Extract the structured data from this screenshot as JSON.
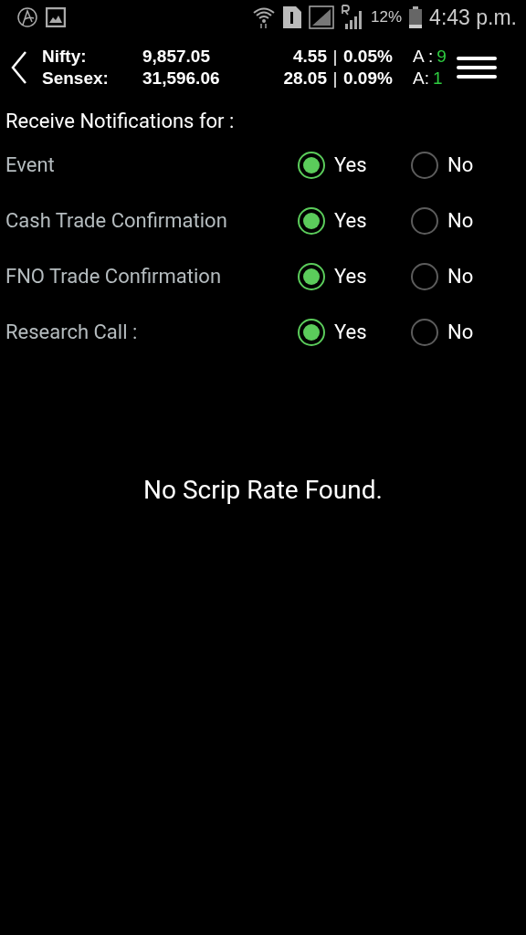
{
  "status_bar": {
    "battery": "12%",
    "time": "4:43 p.m."
  },
  "ticker": [
    {
      "name": "Nifty:",
      "value": "9,857.05",
      "change": "4.55",
      "separator": "|",
      "percent": "0.05%",
      "a_label": "A :",
      "a_value": "9"
    },
    {
      "name": "Sensex:",
      "value": "31,596.06",
      "change": "28.05",
      "separator": "|",
      "percent": "0.09%",
      "a_label": "A:",
      "a_value": "1"
    }
  ],
  "section_title": "Receive Notifications for :",
  "notifications": [
    {
      "label": "Event",
      "options": [
        {
          "label": "Yes",
          "selected": true
        },
        {
          "label": "No",
          "selected": false
        }
      ]
    },
    {
      "label": "Cash Trade Confirmation",
      "options": [
        {
          "label": "Yes",
          "selected": true
        },
        {
          "label": "No",
          "selected": false
        }
      ]
    },
    {
      "label": "FNO Trade Confirmation",
      "options": [
        {
          "label": "Yes",
          "selected": true
        },
        {
          "label": "No",
          "selected": false
        }
      ]
    },
    {
      "label": "Research Call :",
      "options": [
        {
          "label": "Yes",
          "selected": true
        },
        {
          "label": "No",
          "selected": false
        }
      ]
    }
  ],
  "empty_message": "No Scrip Rate Found."
}
